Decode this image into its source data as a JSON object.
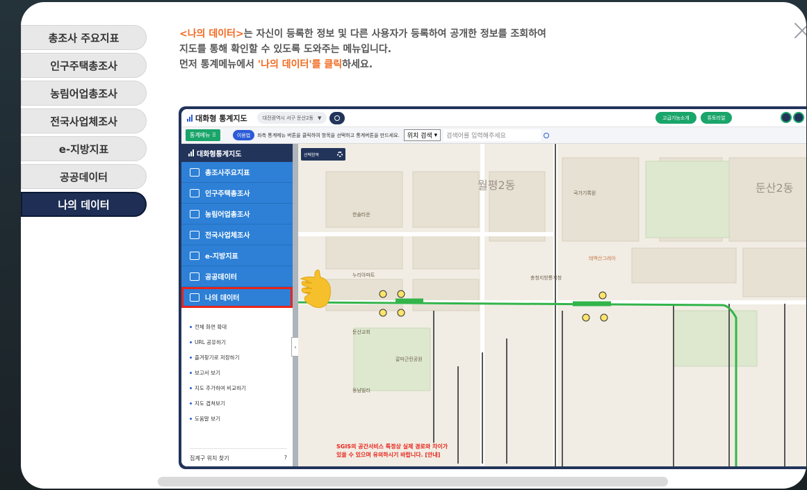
{
  "sidebar_tabs": [
    {
      "label": "총조사 주요지표"
    },
    {
      "label": "인구주택총조사"
    },
    {
      "label": "농림어업총조사"
    },
    {
      "label": "전국사업체조사"
    },
    {
      "label": "e-지방지표"
    },
    {
      "label": "공공데이터"
    },
    {
      "label": "나의 데이터",
      "active": true
    }
  ],
  "description": {
    "line1_highlight": "<나의 데이터>",
    "line1_rest": "는 자신이 등록한 정보 및 다른 사용자가 등록하여 공개한 정보를 조회하여",
    "line2": "지도를 통해 확인할 수 있도록 도와주는 메뉴입니다.",
    "line3_pre": "먼저 통계메뉴에서 ",
    "line3_highlight": "'나의 데이터'를 클릭",
    "line3_post": "하세요."
  },
  "screenshot": {
    "app_title": "대화형 통계지도",
    "address": "대전광역시 서구 둔산2동",
    "btn_advanced": "고급기능소개",
    "btn_tutorial": "튜토리얼",
    "menu_btn": "통계메뉴",
    "use_btn": "이용법",
    "hint": "좌측 통계메뉴 버튼을 클릭하여 항목을 선택하고 통계버튼을 만드세요.",
    "search_select": "위치 검색",
    "search_placeholder": "검색어를 입력해주세요",
    "panel_title": "대화형통계지도",
    "panel_menu": [
      "총조사주요지표",
      "인구주택총조사",
      "농림어업총조사",
      "전국사업체조사",
      "e-지방지표",
      "공공데이터",
      "나의 데이터"
    ],
    "panel_links": [
      "전체 화면 확대",
      "URL 공유하기",
      "즐겨찾기로 저장하기",
      "보고서 보기",
      "지도 추가하여 비교하기",
      "지도 겹쳐보기",
      "도움말 보기"
    ],
    "panel_footer": "집계구 위치 찾기",
    "map_select_btn": "선택항목",
    "map_labels": {
      "wolpyeong": "월평2동",
      "dunsan": "둔산2동",
      "hansol": "한솔타운",
      "nuri": "누리아파트",
      "chungnam": "충청지방통계청",
      "dunsan_church": "둔산교회",
      "galma": "갈마근린공원",
      "dongnam": "동남빌라",
      "taebaek": "태백산그레아",
      "bukgyeong": "국가기록원"
    },
    "warning_line1": "SGIS의 공간서비스 특정상 실제 경로와 차이가",
    "warning_line2": "있을 수 있으며 유의하시기 바랍니다. [안내]"
  }
}
